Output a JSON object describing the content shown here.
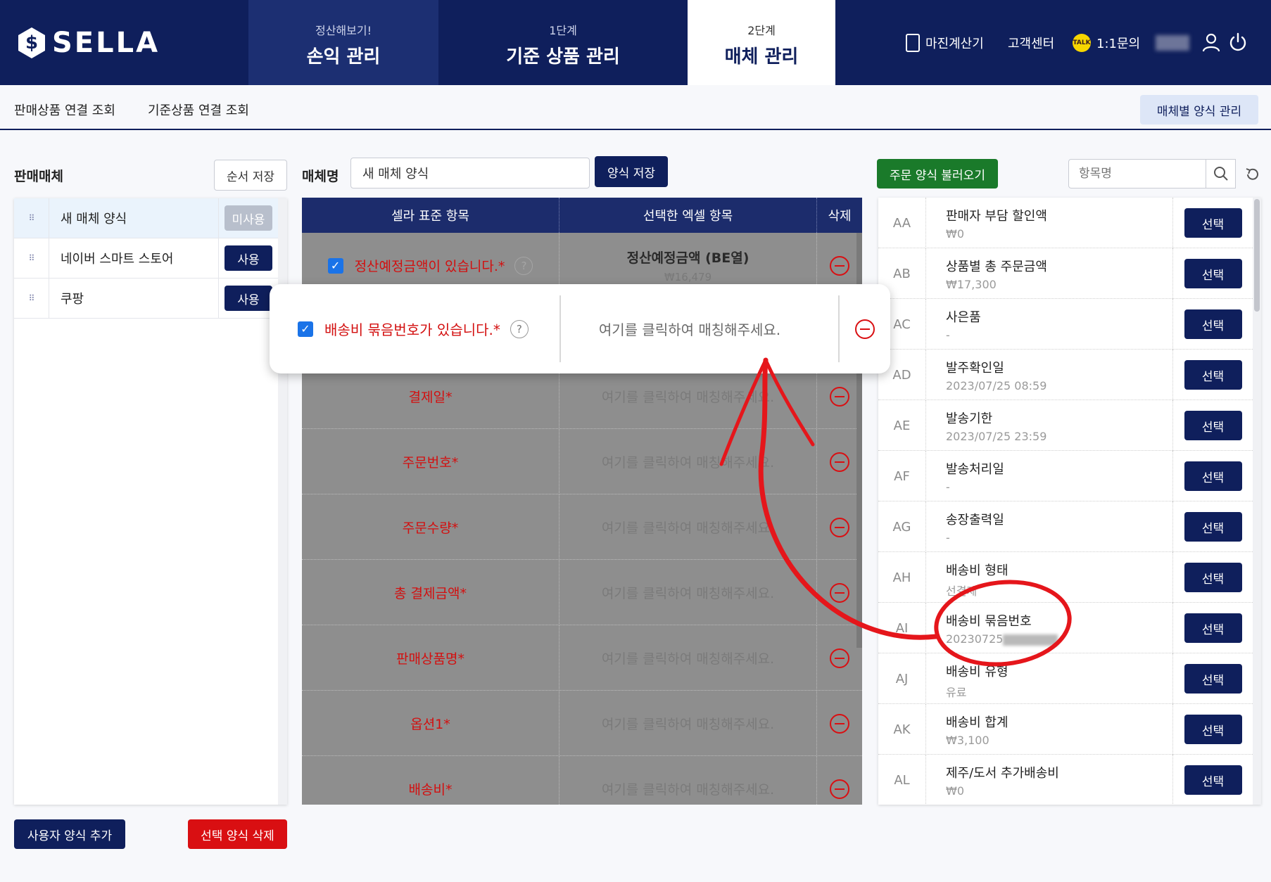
{
  "brand": {
    "logo_text": "SELLA"
  },
  "nav": {
    "tabs": [
      {
        "sub": "정산해보기!",
        "label": "손익 관리"
      },
      {
        "sub": "1단계",
        "label": "기준 상품 관리"
      },
      {
        "sub": "2단계",
        "label": "매체 관리"
      }
    ],
    "links": {
      "margin_calc": "마진계산기",
      "support": "고객센터",
      "inquiry": "1:1문의",
      "kakao_badge": "TALK"
    }
  },
  "subnav": {
    "sales_link": "판매상품 연결 조회",
    "base_link": "기준상품 연결 조회",
    "format_manage": "매체별 양식 관리"
  },
  "left": {
    "title": "판매매체",
    "order_save": "순서 저장",
    "rows": [
      {
        "name": "새 매체 양식",
        "status": "미사용"
      },
      {
        "name": "네이버 스마트 스토어",
        "status": "사용"
      },
      {
        "name": "쿠팡",
        "status": "사용"
      }
    ],
    "add_button": "사용자 양식 추가",
    "delete_button": "선택 양식 삭제"
  },
  "middle": {
    "media_name_label": "매체명",
    "media_name_value": "새 매체 양식",
    "save_button": "양식 저장",
    "headers": {
      "standard": "셀라 표준 항목",
      "selected": "선택한 엑셀 항목",
      "delete": "삭제"
    },
    "first_row": {
      "label": "정산예정금액이 있습니다.*",
      "value": "정산예정금액 (BE열)",
      "sub": "₩16,479"
    },
    "rows": [
      {
        "label": "결제일*",
        "placeholder": "여기를 클릭하여 매칭해주세요."
      },
      {
        "label": "주문번호*",
        "placeholder": "여기를 클릭하여 매칭해주세요."
      },
      {
        "label": "주문수량*",
        "placeholder": "여기를 클릭하여 매칭해주세요."
      },
      {
        "label": "총 결제금액*",
        "placeholder": "여기를 클릭하여 매칭해주세요."
      },
      {
        "label": "판매상품명*",
        "placeholder": "여기를 클릭하여 매칭해주세요."
      },
      {
        "label": "옵션1*",
        "placeholder": "여기를 클릭하여 매칭해주세요."
      },
      {
        "label": "배송비*",
        "placeholder": "여기를 클릭하여 매칭해주세요."
      }
    ],
    "popup": {
      "label": "배송비 묶음번호가 있습니다.*",
      "placeholder": "여기를 클릭하여 매칭해주세요."
    }
  },
  "right": {
    "load_button": "주문 양식 불러오기",
    "search_placeholder": "항목명",
    "select_label": "선택",
    "items": [
      {
        "code": "AA",
        "name": "판매자 부담 할인액",
        "value": "₩0"
      },
      {
        "code": "AB",
        "name": "상품별 총 주문금액",
        "value": "₩17,300"
      },
      {
        "code": "AC",
        "name": "사은품",
        "value": "-"
      },
      {
        "code": "AD",
        "name": "발주확인일",
        "value": "2023/07/25 08:59"
      },
      {
        "code": "AE",
        "name": "발송기한",
        "value": "2023/07/25 23:59"
      },
      {
        "code": "AF",
        "name": "발송처리일",
        "value": "-"
      },
      {
        "code": "AG",
        "name": "송장출력일",
        "value": "-"
      },
      {
        "code": "AH",
        "name": "배송비 형태",
        "value": "선결제"
      },
      {
        "code": "AI",
        "name": "배송비 묶음번호",
        "value": "20230725"
      },
      {
        "code": "AJ",
        "name": "배송비 유형",
        "value": "유료"
      },
      {
        "code": "AK",
        "name": "배송비 합계",
        "value": "₩3,100"
      },
      {
        "code": "AL",
        "name": "제주/도서 추가배송비",
        "value": "₩0"
      }
    ]
  },
  "colors": {
    "navy": "#0f1f5c",
    "red": "#d90f12",
    "green": "#1a7a2a",
    "annotation": "#e5161b"
  }
}
